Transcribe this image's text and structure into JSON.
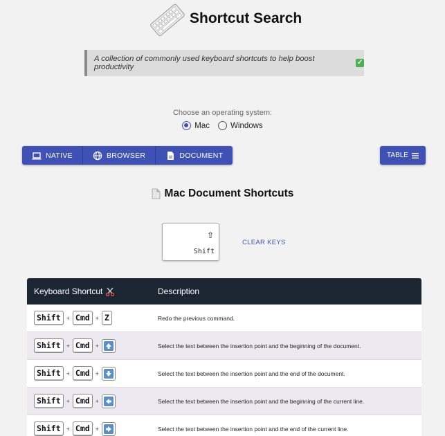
{
  "header": {
    "title": "Shortcut Search",
    "logo_icon": "keyboard-icon"
  },
  "intro": {
    "text": "A collection of commonly used keyboard shortcuts to help boost productivity",
    "emoji": "✅"
  },
  "os_selector": {
    "label": "Choose an operating system:",
    "options": [
      {
        "label": "Mac",
        "selected": true
      },
      {
        "label": "Windows",
        "selected": false
      }
    ]
  },
  "category_buttons": [
    {
      "label": "NATIVE",
      "icon": "laptop-icon"
    },
    {
      "label": "BROWSER",
      "icon": "globe-icon"
    },
    {
      "label": "DOCUMENT",
      "icon": "document-icon"
    }
  ],
  "table_button": {
    "label": "TABLE",
    "icon": "list-icon"
  },
  "section": {
    "title": "Mac Document Shortcuts",
    "icon": "page-icon"
  },
  "key_filter": {
    "symbol": "⇧",
    "name": "Shift",
    "clear_label": "CLEAR KEYS"
  },
  "table": {
    "headers": [
      "Keyboard Shortcut",
      "Description"
    ],
    "header_icon": "scissors-icon",
    "rows": [
      {
        "keys": [
          "Shift",
          "Cmd",
          "Z"
        ],
        "description": "Redo the previous command."
      },
      {
        "keys": [
          "Shift",
          "Cmd",
          "up-arrow"
        ],
        "description": "Select the text between the insertion point and the beginning of the document."
      },
      {
        "keys": [
          "Shift",
          "Cmd",
          "down-arrow"
        ],
        "description": "Select the text between the insertion point and the end of the document."
      },
      {
        "keys": [
          "Shift",
          "Cmd",
          "left-arrow"
        ],
        "description": "Select the text between the insertion point and the beginning of the current line."
      },
      {
        "keys": [
          "Shift",
          "Cmd",
          "right-arrow"
        ],
        "description": "Select the text between the insertion point and the end of the current line."
      }
    ]
  },
  "colors": {
    "primary": "#3f51b5",
    "table_header": "#1c2733",
    "row_alt": "#eceaf0"
  }
}
